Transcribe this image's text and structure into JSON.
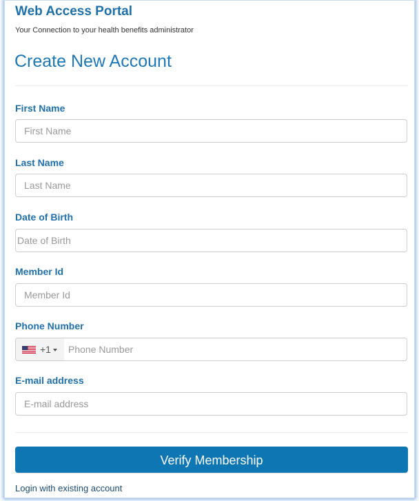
{
  "header": {
    "portal_title": "Web Access Portal",
    "portal_subtitle": "Your Connection to your health benefits administrator",
    "page_title": "Create New Account"
  },
  "form": {
    "first_name": {
      "label": "First Name",
      "placeholder": "First Name",
      "value": ""
    },
    "last_name": {
      "label": "Last Name",
      "placeholder": "Last Name",
      "value": ""
    },
    "date_of_birth": {
      "label": "Date of Birth",
      "placeholder": "Date of Birth",
      "value": ""
    },
    "member_id": {
      "label": "Member Id",
      "placeholder": "Member Id",
      "value": ""
    },
    "phone": {
      "label": "Phone Number",
      "placeholder": "Phone Number",
      "value": "",
      "country_flag_icon": "us-flag-icon",
      "dial_code": "+1"
    },
    "email": {
      "label": "E-mail address",
      "placeholder": "E-mail address",
      "value": ""
    }
  },
  "actions": {
    "verify_label": "Verify Membership",
    "login_link": "Login with existing account"
  },
  "colors": {
    "heading": "#1f6fa8",
    "page_title": "#1f77b4",
    "button": "#0e76b3",
    "frame_glow": "#4682c8"
  }
}
